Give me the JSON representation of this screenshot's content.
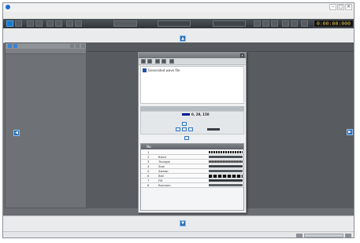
{
  "window": {
    "title": "",
    "controls": {
      "minimize": "–",
      "maximize": "□",
      "close": "✕"
    }
  },
  "menubar": {
    "items": [
      "",
      "",
      "",
      "",
      "",
      "",
      "",
      "",
      "",
      "",
      "",
      "",
      "",
      "",
      ""
    ]
  },
  "toolbar": {
    "label1": "",
    "label2": "",
    "label3": "",
    "label4": "",
    "timecode": "0:00:00:000"
  },
  "left_panel": {
    "tabs": [
      "",
      "",
      "",
      ""
    ]
  },
  "dialog": {
    "title": "",
    "close": "✕",
    "file": {
      "name": "Generated wave file"
    },
    "info_header": "",
    "info": {
      "row1_label": "",
      "row1_value": "0, 29, 150",
      "row2_label": "",
      "row2_value": "",
      "row3_label": "",
      "row3_value": "",
      "row4_label": "",
      "row4_value": ""
    },
    "table": {
      "headers": {
        "no": "No.",
        "name": "",
        "image": ""
      },
      "rows": [
        {
          "no": "1",
          "name": ""
        },
        {
          "no": "2",
          "name": "Block"
        },
        {
          "no": "3",
          "name": "Triangle"
        },
        {
          "no": "4",
          "name": "Saw"
        },
        {
          "no": "5",
          "name": "Sweep"
        },
        {
          "no": "6",
          "name": "Bell"
        },
        {
          "no": "7",
          "name": "FM"
        },
        {
          "no": "8",
          "name": "Random"
        }
      ]
    }
  },
  "arrows": {
    "up": "▲",
    "down": "▼",
    "left": "◀",
    "right": "▶"
  },
  "colors": {
    "accent": "#1a78c9",
    "timecode": "#e8c640",
    "rgb_swatch": "#001d96"
  }
}
